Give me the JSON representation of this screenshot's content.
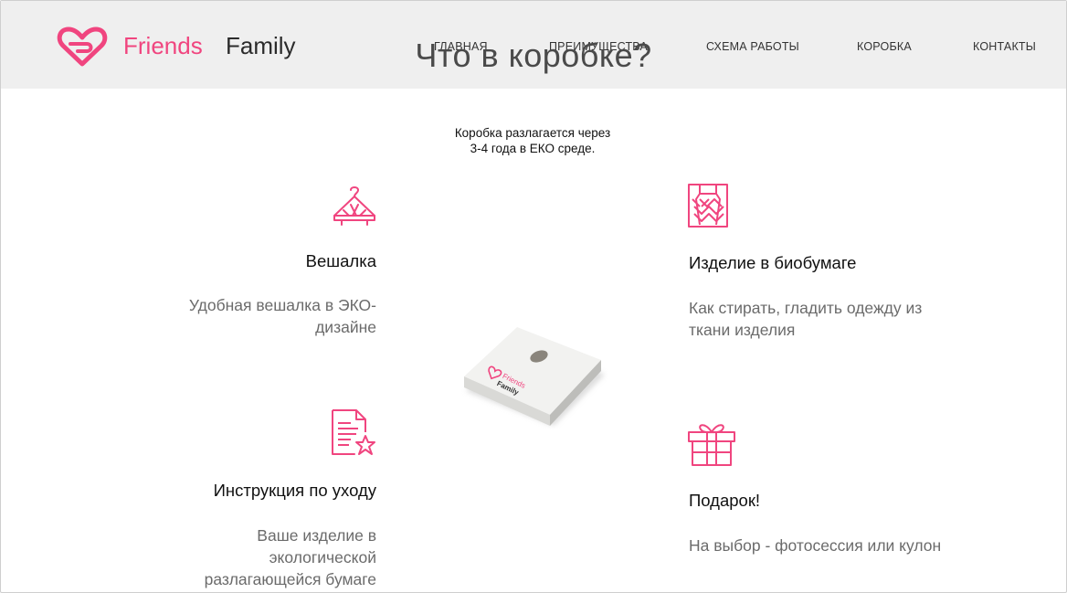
{
  "brand": {
    "word1": "Friends",
    "word2": "Family",
    "accent": "#f0457f"
  },
  "nav": [
    {
      "label": "ГЛАВНАЯ"
    },
    {
      "label": "ПРЕИМУЩЕСТВА"
    },
    {
      "label": "СХЕМА РАБОТЫ"
    },
    {
      "label": "КОРОБКА"
    },
    {
      "label": "КОНТАКТЫ"
    }
  ],
  "section": {
    "title": "Что в коробке?",
    "eco_note": "Коробка разлагается через 3-4 года в ЕКО среде."
  },
  "features": [
    {
      "icon": "hanger-icon",
      "title": "Вешалка",
      "desc": "Удобная вешалка в ЭКО-дизайне"
    },
    {
      "icon": "sweater-icon",
      "title": "Изделие в биобумаге",
      "desc": "Как стирать, гладить одежду из ткани изделия"
    },
    {
      "icon": "document-star-icon",
      "title": "Инструкция по уходу",
      "desc": "Ваше изделие в экологической разлагающейся бумаге"
    },
    {
      "icon": "gift-icon",
      "title": "Подарок!",
      "desc": "На выбор - фотосессия или кулон"
    }
  ],
  "product_box": {
    "label1": "Friends",
    "label2": "Family"
  }
}
